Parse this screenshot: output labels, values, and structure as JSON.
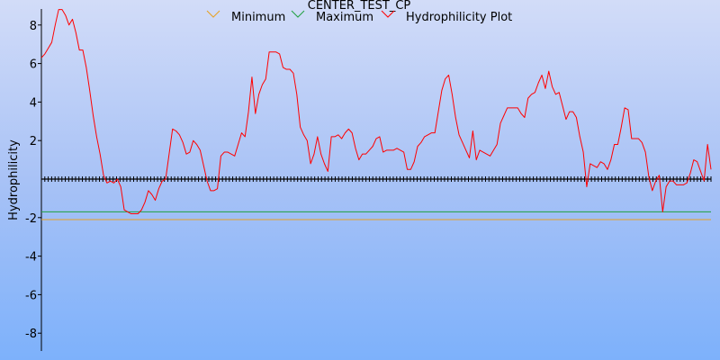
{
  "chart_data": {
    "type": "line",
    "title": "CENTER_TEST_CP",
    "xlabel": "",
    "ylabel": "Hydrophilicity",
    "ylim": [
      -9,
      9
    ],
    "y_ticks": [
      8,
      6,
      4,
      2,
      -2,
      -4,
      -6,
      -8
    ],
    "legend_position": "top-center",
    "grid": false,
    "zero_line_ticks": 197,
    "series": [
      {
        "name": "Minimum",
        "type": "constant",
        "value": -2.1,
        "color": "#e8a020"
      },
      {
        "name": "Maximum",
        "type": "constant",
        "value": -1.7,
        "color": "#20a040"
      },
      {
        "name": "Hydrophilicity Plot",
        "color": "#ff0000",
        "x_count": 197,
        "values": [
          6.3,
          6.5,
          6.8,
          7.1,
          8.0,
          8.8,
          8.8,
          8.5,
          8.0,
          8.3,
          7.6,
          6.7,
          6.7,
          5.8,
          4.6,
          3.3,
          2.2,
          1.3,
          0.2,
          -0.2,
          -0.1,
          -0.2,
          0.0,
          -0.4,
          -1.6,
          -1.7,
          -1.8,
          -1.8,
          -1.8,
          -1.6,
          -1.2,
          -0.6,
          -0.8,
          -1.1,
          -0.5,
          -0.1,
          0.0,
          1.3,
          2.6,
          2.5,
          2.3,
          1.9,
          1.3,
          1.4,
          2.0,
          1.8,
          1.5,
          0.7,
          -0.1,
          -0.6,
          -0.6,
          -0.5,
          1.2,
          1.4,
          1.4,
          1.3,
          1.2,
          1.8,
          2.4,
          2.2,
          3.5,
          5.3,
          3.4,
          4.4,
          4.9,
          5.2,
          6.6,
          6.6,
          6.6,
          6.5,
          5.8,
          5.7,
          5.7,
          5.5,
          4.4,
          2.7,
          2.3,
          2.0,
          0.8,
          1.3,
          2.2,
          1.3,
          0.8,
          0.4,
          2.2,
          2.2,
          2.3,
          2.1,
          2.4,
          2.6,
          2.4,
          1.6,
          1.0,
          1.3,
          1.3,
          1.5,
          1.7,
          2.1,
          2.2,
          1.4,
          1.5,
          1.5,
          1.5,
          1.6,
          1.5,
          1.4,
          0.5,
          0.5,
          0.9,
          1.7,
          1.9,
          2.2,
          2.3,
          2.4,
          2.4,
          3.5,
          4.6,
          5.2,
          5.4,
          4.4,
          3.2,
          2.3,
          1.9,
          1.5,
          1.1,
          2.5,
          1.0,
          1.5,
          1.4,
          1.3,
          1.2,
          1.5,
          1.8,
          2.9,
          3.3,
          3.7,
          3.7,
          3.7,
          3.7,
          3.4,
          3.2,
          4.2,
          4.4,
          4.5,
          5.0,
          5.4,
          4.7,
          5.6,
          4.8,
          4.4,
          4.5,
          3.8,
          3.1,
          3.5,
          3.5,
          3.2,
          2.2,
          1.4,
          -0.4,
          0.8,
          0.7,
          0.6,
          0.9,
          0.8,
          0.5,
          1.0,
          1.8,
          1.8,
          2.7,
          3.7,
          3.6,
          2.1,
          2.1,
          2.1,
          1.9,
          1.4,
          0.1,
          -0.6,
          -0.1,
          0.2,
          -1.7,
          -0.4,
          -0.1,
          -0.1,
          -0.3,
          -0.3,
          -0.3,
          -0.2,
          0.3,
          1.0,
          0.9,
          0.4,
          -0.1,
          1.8,
          0.5
        ]
      }
    ]
  }
}
